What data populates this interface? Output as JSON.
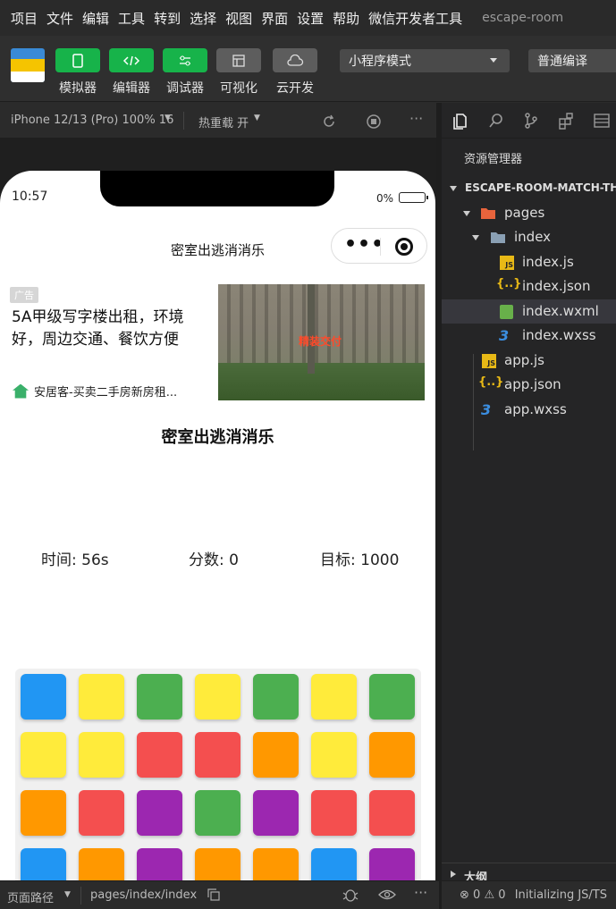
{
  "menubar": {
    "items": [
      "项目",
      "文件",
      "编辑",
      "工具",
      "转到",
      "选择",
      "视图",
      "界面",
      "设置",
      "帮助",
      "微信开发者工具"
    ],
    "title": "escape-room"
  },
  "toolbar": {
    "buttons": [
      {
        "label": "模拟器",
        "icon": "phone-icon"
      },
      {
        "label": "编辑器",
        "icon": "code-icon"
      },
      {
        "label": "调试器",
        "icon": "sliders-icon"
      },
      {
        "label": "可视化",
        "icon": "layout-icon"
      },
      {
        "label": "云开发",
        "icon": "cloud-icon"
      }
    ],
    "mode_select": "小程序模式",
    "compile_select": "普通编译"
  },
  "simulator_bar": {
    "device": "iPhone 12/13 (Pro) 100% 16",
    "hot_reload": "热重载 开"
  },
  "phone": {
    "status": {
      "time": "10:57",
      "battery": "0%"
    },
    "nav_title": "密室出逃消消乐",
    "ad": {
      "tag": "广告",
      "text": "5A甲级写字楼出租，环境好，周边交通、餐饮方便",
      "image_caption": "精装交付",
      "source": "安居客-买卖二手房新房租..."
    },
    "game": {
      "title": "密室出逃消消乐",
      "time_label": "时间: 56s",
      "score_label": "分数: 0",
      "target_label": "目标: 1000",
      "board": [
        [
          "blue",
          "yellow",
          "green",
          "yellow",
          "green",
          "yellow",
          "green"
        ],
        [
          "yellow",
          "yellow",
          "red",
          "red",
          "orange",
          "yellow",
          "orange"
        ],
        [
          "orange",
          "red",
          "purple",
          "green",
          "purple",
          "red",
          "red"
        ],
        [
          "blue",
          "orange",
          "purple",
          "orange",
          "orange",
          "blue",
          "purple"
        ]
      ],
      "colors": {
        "blue": "#2196f3",
        "yellow": "#ffeb3b",
        "green": "#4caf50",
        "red": "#f44f4f",
        "orange": "#ff9800",
        "purple": "#9c27b0"
      }
    }
  },
  "explorer": {
    "title": "资源管理器",
    "project": "ESCAPE-ROOM-MATCH-TH",
    "tree": {
      "pages": "pages",
      "index": "index",
      "index_js": "index.js",
      "index_json": "index.json",
      "index_wxml": "index.wxml",
      "index_wxss": "index.wxss",
      "app_js": "app.js",
      "app_json": "app.json",
      "app_wxss": "app.wxss"
    },
    "outline": "大纲"
  },
  "bottombar": {
    "path_label": "页面路径",
    "page_path": "pages/index/index",
    "errors": "0",
    "warnings": "0",
    "status": "Initializing JS/TS"
  }
}
